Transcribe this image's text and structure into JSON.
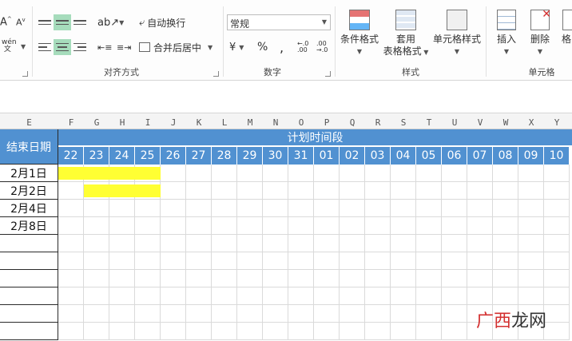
{
  "ribbon": {
    "alignment": {
      "wrap_text_label": "自动换行",
      "merge_center_label": "合并后居中",
      "group_label": "对齐方式"
    },
    "number": {
      "format_value": "常规",
      "percent_symbol": "%",
      "comma_symbol": ",",
      "group_label": "数字"
    },
    "styles": {
      "conditional_format_label": "条件格式",
      "table_format_label_1": "套用",
      "table_format_label_2": "表格格式",
      "cell_styles_label": "单元格样式",
      "group_label": "样式"
    },
    "cells": {
      "insert_label": "插入",
      "delete_label": "删除",
      "format_label": "格",
      "group_label": "单元格"
    }
  },
  "sheet": {
    "column_letters": [
      "E",
      "F",
      "G",
      "H",
      "I",
      "J",
      "K",
      "L",
      "M",
      "N",
      "O",
      "P",
      "Q",
      "R",
      "S",
      "T",
      "U",
      "V",
      "W",
      "X",
      "Y"
    ],
    "end_date_header": "结束日期",
    "plan_header": "计划时间段",
    "days": [
      "22",
      "23",
      "24",
      "25",
      "26",
      "27",
      "28",
      "29",
      "30",
      "31",
      "01",
      "02",
      "03",
      "04",
      "05",
      "06",
      "07",
      "08",
      "09",
      "10"
    ],
    "end_dates": [
      "2月1日",
      "2月2日",
      "2月4日",
      "2月8日",
      "",
      "",
      "",
      "",
      "",
      ""
    ],
    "bars": [
      {
        "row": 0,
        "start_day": "22",
        "end_day": "25"
      },
      {
        "row": 1,
        "start_day": "23",
        "end_day": "25"
      }
    ]
  },
  "colors": {
    "header_blue": "#5191d1",
    "bar_yellow": "#ffff33",
    "selected_align": "#a6dcbc"
  },
  "watermark": {
    "part1": "广西",
    "part2": "龙网"
  }
}
